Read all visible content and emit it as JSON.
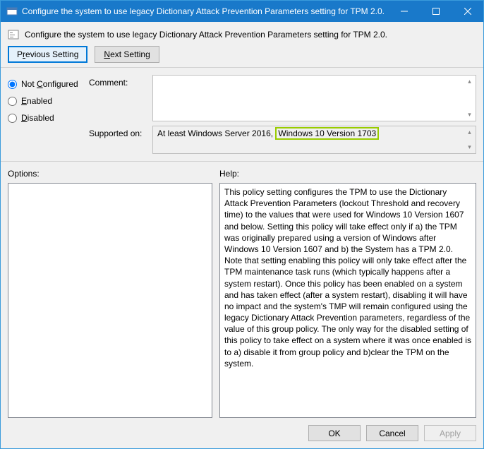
{
  "window": {
    "title": "Configure the system to use legacy Dictionary Attack Prevention Parameters setting for TPM 2.0."
  },
  "subheader": {
    "text": "Configure the system to use legacy Dictionary Attack Prevention Parameters setting for TPM 2.0."
  },
  "nav": {
    "previous_pre": "P",
    "previous_ul": "r",
    "previous_post": "evious Setting",
    "next_pre": "",
    "next_ul": "N",
    "next_post": "ext Setting"
  },
  "state": {
    "not_configured_pre": "Not ",
    "not_configured_ul": "C",
    "not_configured_post": "onfigured",
    "enabled_pre": "",
    "enabled_ul": "E",
    "enabled_post": "nabled",
    "disabled_pre": "",
    "disabled_ul": "D",
    "disabled_post": "isabled"
  },
  "labels": {
    "comment": "Comment:",
    "supported": "Supported on:",
    "options": "Options:",
    "help": "Help:"
  },
  "supported": {
    "prefix": "At least Windows Server 2016,",
    "highlight": "Windows 10 Version 1703"
  },
  "help": {
    "text": "This policy setting configures the TPM to use the Dictionary Attack Prevention Parameters (lockout Threshold and recovery time) to the values that were used for Windows 10 Version 1607 and below. Setting this policy will take effect only if a) the TPM was originally prepared using a version of Windows after Windows 10 Version 1607 and b) the System has a TPM 2.0. Note that setting enabling this policy will only take effect after the TPM maintenance task runs (which typically happens after a system restart). Once this policy has been enabled on a system and has taken effect (after a system restart), disabling it will have no impact and the system's TMP will remain configured using the legacy Dictionary Attack Prevention parameters, regardless of the value of this group policy. The only way for the disabled setting of this policy to take effect on a system where it was once enabled is to a) disable it from group policy and b)clear the TPM on the system."
  },
  "buttons": {
    "ok": "OK",
    "cancel": "Cancel",
    "apply_pre": "",
    "apply_ul": "A",
    "apply_post": "pply"
  }
}
